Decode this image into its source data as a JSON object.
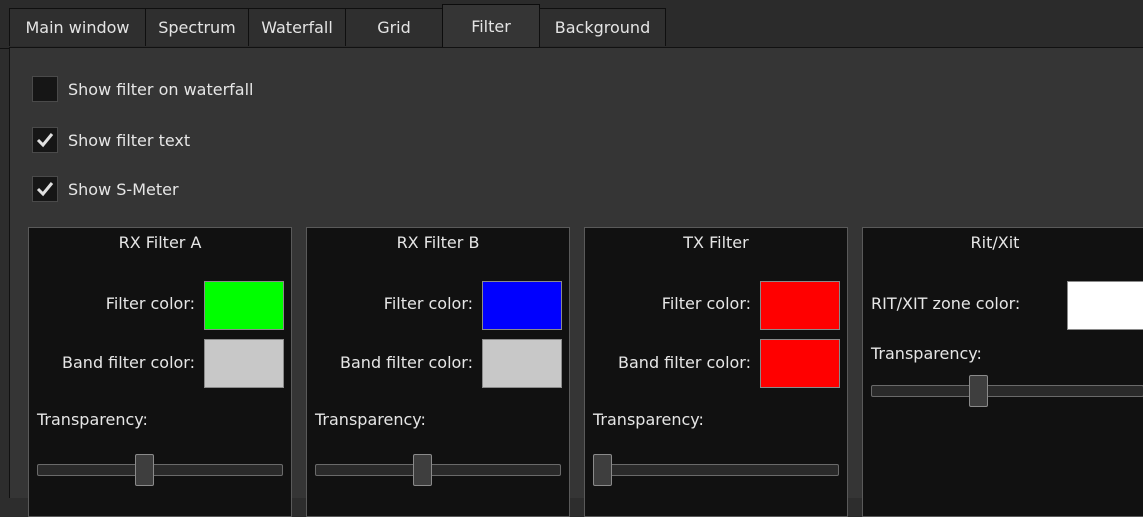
{
  "tabs": [
    {
      "label": "Main window"
    },
    {
      "label": "Spectrum"
    },
    {
      "label": "Waterfall"
    },
    {
      "label": "Grid"
    },
    {
      "label": "Filter",
      "active": true
    },
    {
      "label": "Background"
    }
  ],
  "options": [
    {
      "label": "Show filter on waterfall",
      "checked": false
    },
    {
      "label": "Show filter text",
      "checked": true
    },
    {
      "label": "Show S-Meter",
      "checked": true
    }
  ],
  "groups": [
    {
      "title": "RX Filter A",
      "filter_label": "Filter color:",
      "filter_color": "#00ff00",
      "band_label": "Band filter color:",
      "band_color": "#c8c8c8",
      "transparency_label": "Transparency:",
      "transparency_fraction": 0.43
    },
    {
      "title": "RX Filter B",
      "filter_label": "Filter color:",
      "filter_color": "#0000ff",
      "band_label": "Band filter color:",
      "band_color": "#c8c8c8",
      "transparency_label": "Transparency:",
      "transparency_fraction": 0.43
    },
    {
      "title": "TX Filter",
      "filter_label": "Filter color:",
      "filter_color": "#ff0000",
      "band_label": "Band filter color:",
      "band_color": "#ff0000",
      "transparency_label": "Transparency:",
      "transparency_fraction": 0.0
    },
    {
      "title": "Rit/Xit",
      "zone_label": "RIT/XIT zone color:",
      "zone_color": "#ffffff",
      "transparency_label": "Transparency:",
      "transparency_fraction": 0.43
    }
  ]
}
